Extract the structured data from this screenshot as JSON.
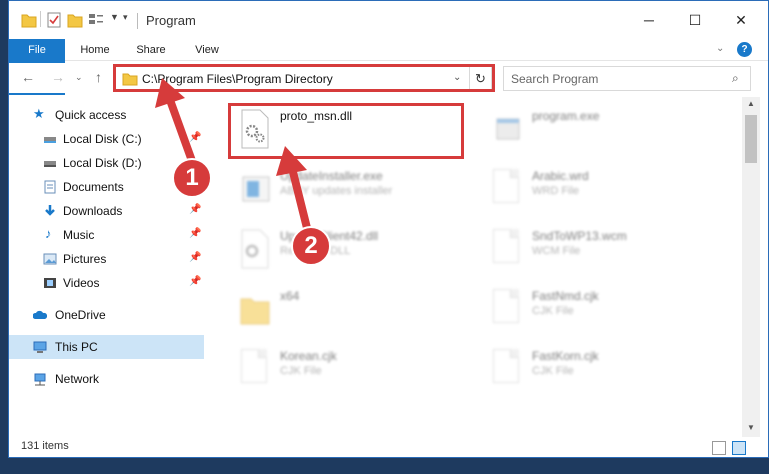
{
  "window": {
    "title": "Program",
    "controls": {
      "minimize": "─",
      "maximize": "☐",
      "close": "✕"
    }
  },
  "ribbon": {
    "tabs": [
      {
        "label": "File"
      },
      {
        "label": "Home"
      },
      {
        "label": "Share"
      },
      {
        "label": "View"
      }
    ]
  },
  "navigation": {
    "address": "C:\\Program Files\\Program Directory",
    "search_placeholder": "Search Program"
  },
  "sidebar": {
    "items": [
      {
        "label": "Quick access",
        "icon": "star-icon",
        "pinned": false
      },
      {
        "label": "Local Disk (C:)",
        "icon": "drive-icon",
        "pinned": true
      },
      {
        "label": "Local Disk (D:)",
        "icon": "drive-icon",
        "pinned": false
      },
      {
        "label": "Documents",
        "icon": "documents-icon",
        "pinned": true
      },
      {
        "label": "Downloads",
        "icon": "download-icon",
        "pinned": true
      },
      {
        "label": "Music",
        "icon": "music-icon",
        "pinned": true
      },
      {
        "label": "Pictures",
        "icon": "pictures-icon",
        "pinned": true
      },
      {
        "label": "Videos",
        "icon": "videos-icon",
        "pinned": true
      },
      {
        "label": "OneDrive",
        "icon": "cloud-icon",
        "pinned": false
      },
      {
        "label": "This PC",
        "icon": "computer-icon",
        "pinned": false,
        "selected": true
      },
      {
        "label": "Network",
        "icon": "network-icon",
        "pinned": false
      }
    ]
  },
  "files": [
    {
      "name": "proto_msn.dll",
      "type": "",
      "icon": "dll-gear-icon",
      "highlighted": true
    },
    {
      "name": "program.exe",
      "type": "",
      "icon": "exe-icon"
    },
    {
      "name": "UpdateInstaller.exe",
      "type": "ABBY updates installer",
      "icon": "installer-icon"
    },
    {
      "name": "Arabic.wrd",
      "type": "WRD File",
      "icon": "file-icon"
    },
    {
      "name": "UpdateClient42.dll",
      "type": "Resource DLL",
      "icon": "dll-gear-icon"
    },
    {
      "name": "SndToWP13.wcm",
      "type": "WCM File",
      "icon": "file-icon"
    },
    {
      "name": "x64",
      "type": "",
      "icon": "folder-icon"
    },
    {
      "name": "FastNmd.cjk",
      "type": "CJK File",
      "icon": "file-icon"
    },
    {
      "name": "Korean.cjk",
      "type": "CJK File",
      "icon": "file-icon"
    },
    {
      "name": "FastKorn.cjk",
      "type": "CJK File",
      "icon": "file-icon"
    }
  ],
  "status": {
    "item_count": "131 items"
  },
  "annotations": {
    "badge1": "1",
    "badge2": "2"
  },
  "colors": {
    "accent": "#1979ca",
    "highlight": "#d63b3b",
    "selected": "#cce4f7"
  }
}
